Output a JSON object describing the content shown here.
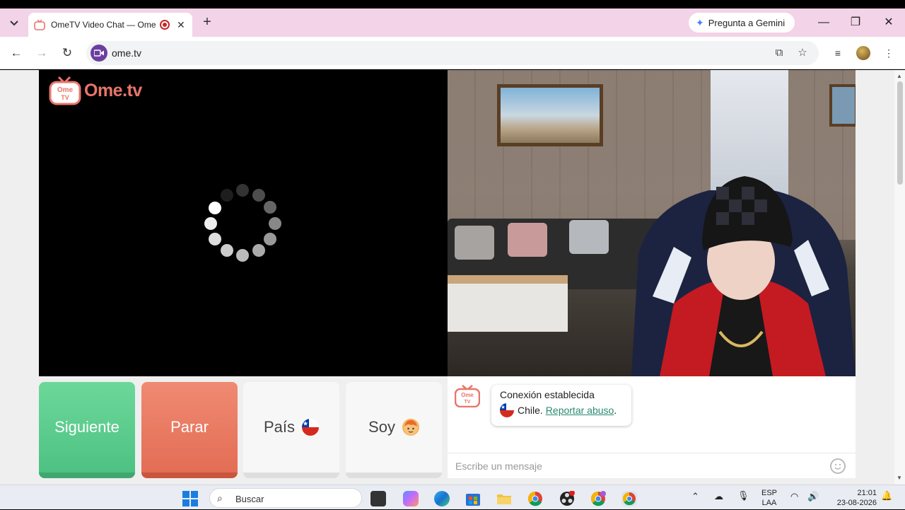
{
  "browser": {
    "tab_title": "OmeTV Video Chat — Ome",
    "gemini_label": "Pregunta a Gemini",
    "url": "ome.tv"
  },
  "site": {
    "logo_badge_top": "Ome",
    "logo_badge_bottom": "TV",
    "logo_text": "Ome.tv"
  },
  "controls": {
    "next_label": "Siguiente",
    "stop_label": "Parar",
    "country_label": "País",
    "me_label": "Soy"
  },
  "chat": {
    "status": "Conexión establecida",
    "country": "Chile.",
    "report_link": "Reportar abuso",
    "report_suffix": ".",
    "input_placeholder": "Escribe un mensaje"
  },
  "taskbar": {
    "search_label": "Buscar",
    "lang_line1": "ESP",
    "lang_line2": "LAA",
    "time": "21:01",
    "date": "23-08-2026"
  },
  "colors": {
    "next_button": "#5cce8f",
    "stop_button": "#e97a62",
    "accent": "#e8756a",
    "link": "#2a8a6e"
  }
}
